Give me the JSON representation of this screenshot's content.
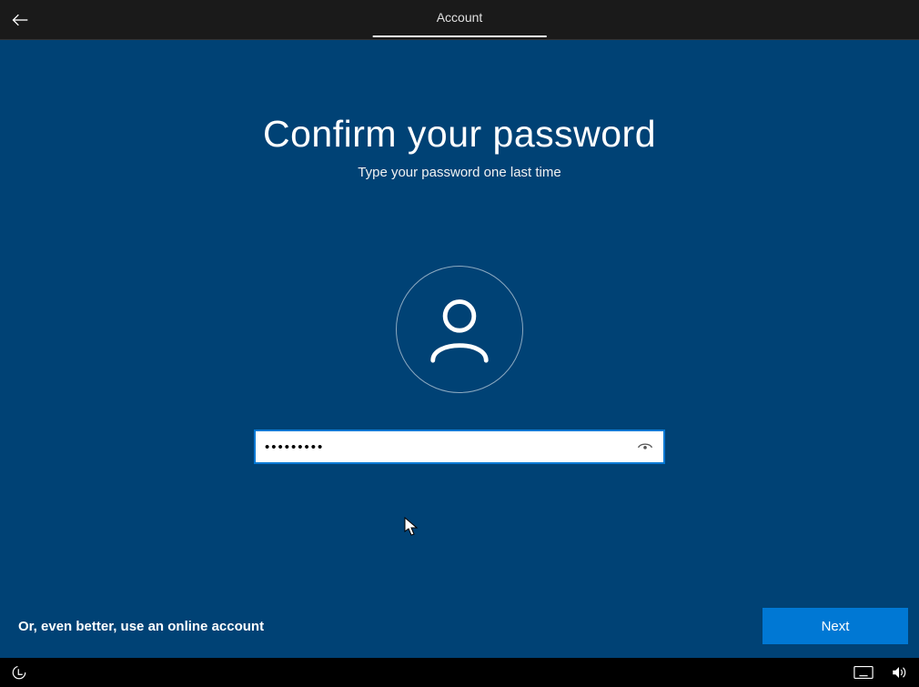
{
  "topbar": {
    "step_label": "Account"
  },
  "page": {
    "title": "Confirm your password",
    "subtitle": "Type your password one last time"
  },
  "form": {
    "password_value": "•••••••••"
  },
  "footer": {
    "online_account_link": "Or, even better, use an online account",
    "next_label": "Next"
  },
  "icons": {
    "back": "back-arrow-icon",
    "avatar": "user-icon",
    "reveal": "password-reveal-icon",
    "accessibility": "accessibility-icon",
    "keyboard": "keyboard-icon",
    "volume": "volume-icon"
  }
}
